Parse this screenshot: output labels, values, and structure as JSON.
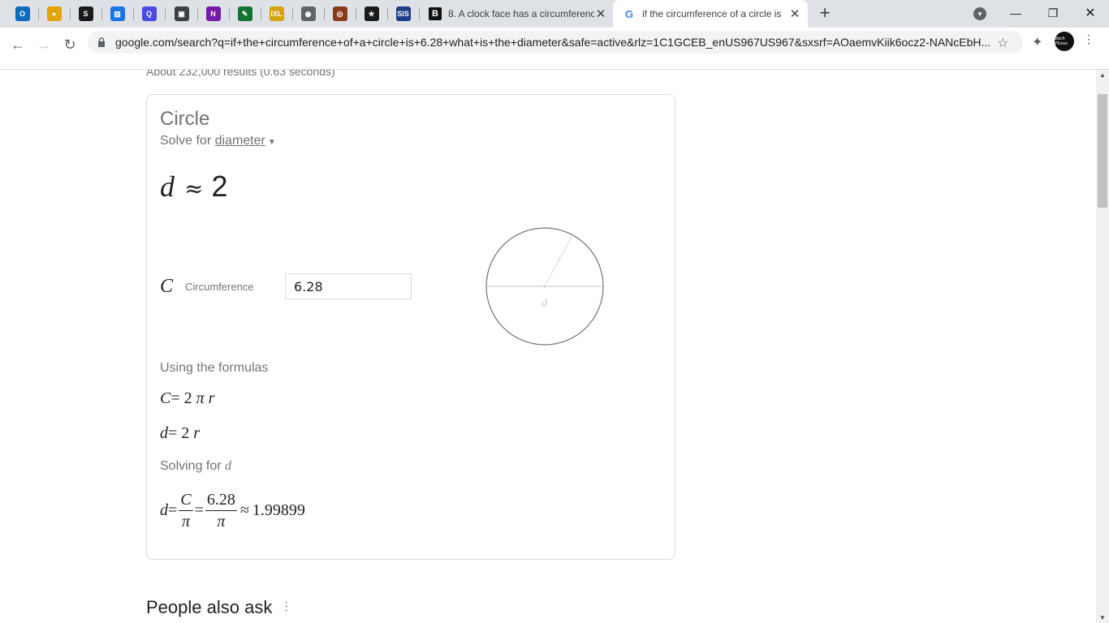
{
  "browser": {
    "tabs": [
      {
        "label": "8. A clock face has a circumferenc",
        "icon": "B"
      },
      {
        "label": "if the circumference of a circle is",
        "icon": "G"
      }
    ],
    "pinned_icons": [
      {
        "name": "outlook-icon",
        "glyph": "O",
        "color": "#0f6cbd"
      },
      {
        "name": "ideas-bulb-icon",
        "glyph": "●",
        "color": "#e3a400"
      },
      {
        "name": "schoology-icon",
        "glyph": "S",
        "color": "#1a1a1a"
      },
      {
        "name": "reading-app-icon",
        "glyph": "▥",
        "color": "#1a73e8"
      },
      {
        "name": "chat-q-icon",
        "glyph": "Q",
        "color": "#4a4ae6"
      },
      {
        "name": "classroom-icon",
        "glyph": "▣",
        "color": "#3c4043"
      },
      {
        "name": "onenote-icon",
        "glyph": "N",
        "color": "#7719aa"
      },
      {
        "name": "pen-app-icon",
        "glyph": "✎",
        "color": "#137333"
      },
      {
        "name": "ixl-icon",
        "glyph": "IXL",
        "color": "#d4a500"
      },
      {
        "name": "globe-icon",
        "glyph": "◉",
        "color": "#5f6368"
      },
      {
        "name": "sports-icon",
        "glyph": "◎",
        "color": "#8a3a1a"
      },
      {
        "name": "army-icon",
        "glyph": "★",
        "color": "#1a1a1a"
      },
      {
        "name": "sis-icon",
        "glyph": "SIS",
        "color": "#1f3c88"
      }
    ],
    "url": "google.com/search?q=if+the+circumference+of+a+circle+is+6.28+what+is+the+diameter&safe=active&rlz=1C1GCEB_enUS967US967&sxsrf=AOaemvKiik6ocz2-NANcEbH...",
    "profile_text": "Bitch Please"
  },
  "results": {
    "count_text": "About 232,000 results (0.63 seconds)"
  },
  "calculator": {
    "title": "Circle",
    "solve_prefix": "Solve for ",
    "solve_target": "diameter",
    "answer_var": "d",
    "answer_approx": "≈",
    "answer_value": "2",
    "input": {
      "symbol": "C",
      "label": "Circumference",
      "value": "6.28"
    },
    "diagram": {
      "radius_label": "r",
      "diameter_label": "d"
    },
    "formulas_heading": "Using the formulas",
    "formula1": {
      "lhs": "C",
      "eq": "= 2 ",
      "pi": "π",
      "var": "r"
    },
    "formula2": {
      "lhs": "d",
      "eq": "= 2 ",
      "var": "r"
    },
    "solving_prefix": "Solving for ",
    "solving_var": "d",
    "solution": {
      "lhs": "d",
      "eq": "=",
      "frac1_num": "C",
      "frac1_den": "π",
      "eq2": "=",
      "frac2_num": "6.28",
      "frac2_den": "π",
      "approx": "≈",
      "result": "1.99899"
    }
  },
  "people_also_ask": {
    "heading": "People also ask"
  }
}
